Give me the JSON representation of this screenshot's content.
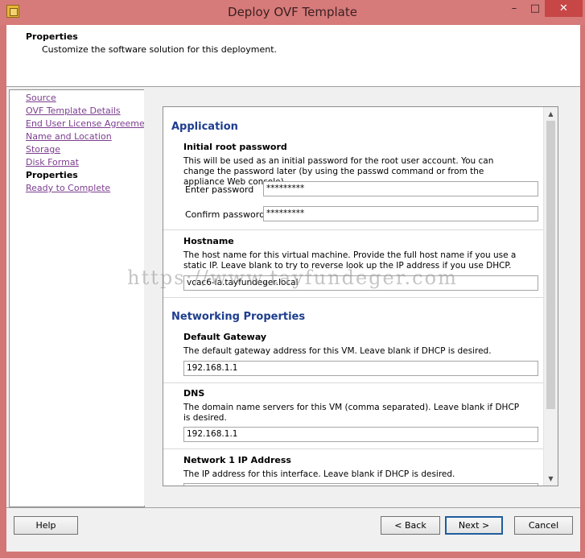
{
  "window": {
    "title": "Deploy OVF Template",
    "minimize": "–",
    "maximize": "□",
    "close": "✕"
  },
  "header": {
    "title": "Properties",
    "subtitle": "Customize the software solution for this deployment."
  },
  "steps": [
    {
      "label": "Source"
    },
    {
      "label": "OVF Template Details"
    },
    {
      "label": "End User License Agreement"
    },
    {
      "label": "Name and Location"
    },
    {
      "label": "Storage"
    },
    {
      "label": "Disk Format"
    },
    {
      "label": "Properties"
    },
    {
      "label": "Ready to Complete"
    }
  ],
  "form": {
    "application": {
      "title": "Application",
      "root_password": {
        "title": "Initial root password",
        "description": "This will be used as an initial password for the root user account. You can change the password later (by using the passwd command or from the appliance Web console).",
        "enter_label": "Enter password",
        "enter_value": "*********",
        "confirm_label": "Confirm password",
        "confirm_value": "*********"
      },
      "hostname": {
        "title": "Hostname",
        "description": "The host name for this virtual machine. Provide the full host name if you use a static IP. Leave blank to try to reverse look up the IP address if you use DHCP.",
        "value": "vcac6-ia.tayfundeger.local"
      }
    },
    "networking": {
      "title": "Networking Properties",
      "gateway": {
        "title": "Default Gateway",
        "description": "The default gateway address for this VM. Leave blank if DHCP is desired.",
        "value": "192.168.1.1"
      },
      "dns": {
        "title": "DNS",
        "description": "The domain name servers for this VM (comma separated). Leave blank if DHCP is desired.",
        "value": "192.168.1.1"
      },
      "ip1": {
        "title": "Network 1 IP Address",
        "description": "The IP address for this interface. Leave blank if DHCP is desired."
      }
    }
  },
  "watermark": "https://www.tayfundeger.com",
  "buttons": {
    "help": "Help",
    "back": "< Back",
    "next": "Next >",
    "cancel": "Cancel"
  }
}
